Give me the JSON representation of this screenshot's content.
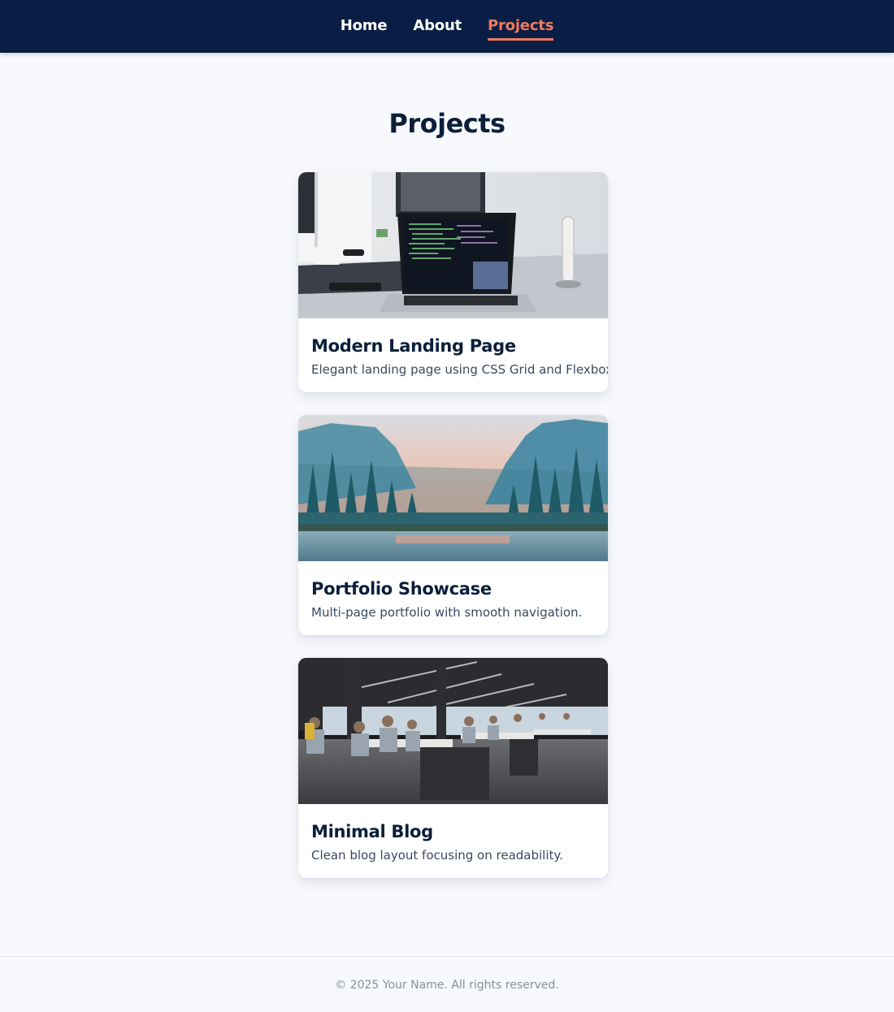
{
  "nav": {
    "items": [
      {
        "label": "Home",
        "active": false
      },
      {
        "label": "About",
        "active": false
      },
      {
        "label": "Projects",
        "active": true
      }
    ],
    "accent_color": "#ee7a5c",
    "background_color": "#0a1e45"
  },
  "main": {
    "title": "Projects",
    "projects": [
      {
        "title": "Modern Landing Page",
        "description": "Elegant landing page using CSS Grid and Flexbox.",
        "image_icon": "laptop-code-photo"
      },
      {
        "title": "Portfolio Showcase",
        "description": "Multi-page portfolio with smooth navigation.",
        "image_icon": "mountain-forest-photo"
      },
      {
        "title": "Minimal Blog",
        "description": "Clean blog layout focusing on readability.",
        "image_icon": "office-workspace-photo"
      }
    ]
  },
  "footer": {
    "text": "© 2025 Your Name. All rights reserved."
  }
}
